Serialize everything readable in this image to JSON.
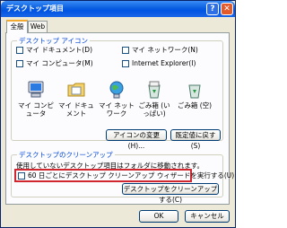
{
  "window": {
    "title": "デスクトップ項目",
    "help_glyph": "?",
    "close_glyph": "✕"
  },
  "tabs": [
    {
      "label": "全般",
      "active": true
    },
    {
      "label": "Web",
      "active": false
    }
  ],
  "desktop_icons_group": {
    "legend": "デスクトップ アイコン",
    "checkboxes": [
      {
        "label": "マイ ドキュメント(D)",
        "checked": false
      },
      {
        "label": "マイ ネットワーク(N)",
        "checked": false
      },
      {
        "label": "マイ コンピュータ(M)",
        "checked": false
      },
      {
        "label": "Internet Explorer(I)",
        "checked": false
      }
    ],
    "icons": [
      {
        "label": "マイ コンピュータ",
        "icon": "my-computer-icon"
      },
      {
        "label": "マイ ドキュメント",
        "icon": "my-documents-icon"
      },
      {
        "label": "マイ ネットワーク",
        "icon": "my-network-icon"
      },
      {
        "label": "ごみ箱 (いっぱい)",
        "icon": "recycle-bin-full-icon"
      },
      {
        "label": "ごみ箱 (空)",
        "icon": "recycle-bin-empty-icon"
      }
    ],
    "change_icon_button": "アイコンの変更(H)...",
    "restore_default_button": "既定値に戻す(S)"
  },
  "cleanup_group": {
    "legend": "デスクトップのクリーンアップ",
    "description": "使用していないデスクトップ項目はフォルダに移動されます。",
    "checkbox_label": "60 日ごとにデスクトップ クリーンアップ ウィザードを実行する(U)",
    "checkbox_checked": false,
    "cleanup_button": "デスクトップをクリーンアップする(C)"
  },
  "footer": {
    "ok_button": "OK",
    "cancel_button": "キャンセル"
  },
  "colors": {
    "titlebar": "#0054e3",
    "legend_text": "#0046d5",
    "highlight_border": "#d0262f"
  }
}
